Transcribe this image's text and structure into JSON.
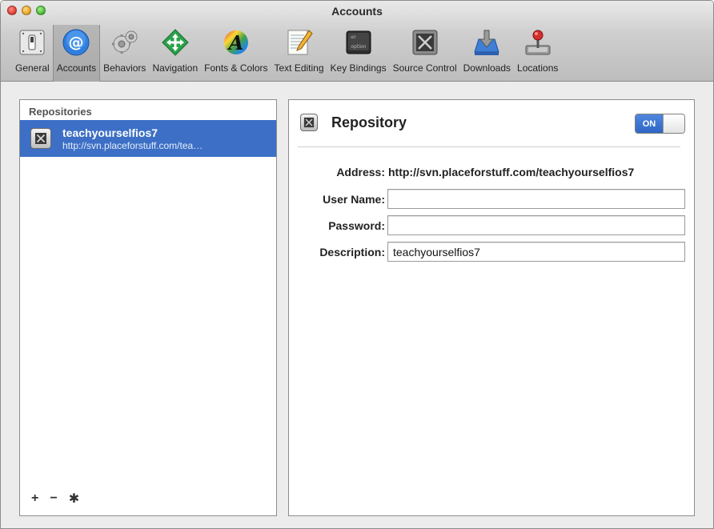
{
  "window": {
    "title": "Accounts"
  },
  "toolbar": {
    "items": [
      {
        "label": "General",
        "icon": "general-switch-icon"
      },
      {
        "label": "Accounts",
        "icon": "at-sign-icon",
        "selected": true
      },
      {
        "label": "Behaviors",
        "icon": "gears-icon"
      },
      {
        "label": "Navigation",
        "icon": "navigation-arrows-icon"
      },
      {
        "label": "Fonts & Colors",
        "icon": "fonts-colors-icon"
      },
      {
        "label": "Text Editing",
        "icon": "text-editing-icon"
      },
      {
        "label": "Key Bindings",
        "icon": "option-key-icon"
      },
      {
        "label": "Source Control",
        "icon": "source-control-icon"
      },
      {
        "label": "Downloads",
        "icon": "downloads-icon"
      },
      {
        "label": "Locations",
        "icon": "locations-joystick-icon"
      }
    ]
  },
  "sidebar": {
    "header": "Repositories",
    "items": [
      {
        "name": "teachyourselfios7",
        "url": "http://svn.placeforstuff.com/tea…",
        "selected": true
      }
    ],
    "footer": {
      "add": "+",
      "remove": "−",
      "settings": "✱"
    }
  },
  "detail": {
    "title": "Repository",
    "toggle": {
      "label": "ON",
      "state": true
    },
    "address": {
      "label": "Address:",
      "value": "http://svn.placeforstuff.com/teachyourselfios7"
    },
    "username": {
      "label": "User Name:",
      "value": ""
    },
    "password": {
      "label": "Password:",
      "value": ""
    },
    "description": {
      "label": "Description:",
      "value": "teachyourselfios7"
    }
  },
  "colors": {
    "selection": "#3c6fc5",
    "toggle_on": "#2f66c4"
  }
}
